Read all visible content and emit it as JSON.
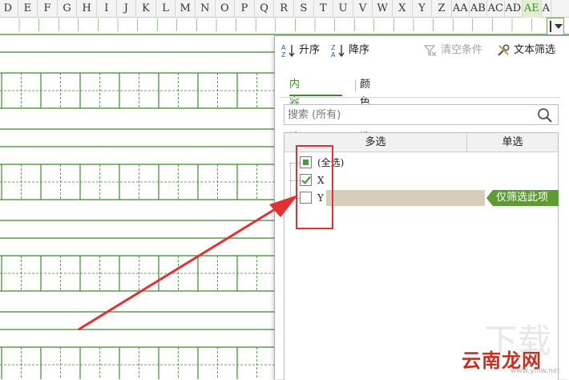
{
  "columns": [
    "D",
    "E",
    "F",
    "G",
    "H",
    "I",
    "J",
    "K",
    "L",
    "M",
    "N",
    "O",
    "P",
    "Q",
    "R",
    "S",
    "T",
    "U",
    "V",
    "W",
    "X",
    "Y",
    "Z",
    "AA",
    "AB",
    "AC",
    "AD",
    "AE",
    "A"
  ],
  "active_column": "AE",
  "toolbar": {
    "sort_asc": "升序",
    "sort_desc": "降序",
    "clear_conditions": "清空条件",
    "text_filter": "文本筛选"
  },
  "tabs": [
    {
      "label": "内容筛选",
      "active": true
    },
    {
      "label": "颜色筛选",
      "active": false
    }
  ],
  "search": {
    "placeholder": "搜索 (所有)"
  },
  "list": {
    "header_multi": "多选",
    "header_single": "单选",
    "items": [
      {
        "label": "(全选)",
        "state": "partial"
      },
      {
        "label": "X",
        "state": "checked"
      },
      {
        "label": "Y",
        "state": "unchecked",
        "hovered": true
      }
    ],
    "only_this_label": "仅筛选此项"
  },
  "colors": {
    "accent_green": "#3f8f2f",
    "grid_green": "#3a8a2a",
    "annotation_red": "#e33030",
    "only_this_bg": "#5e9b34"
  },
  "watermark": {
    "brand": "云南龙网",
    "url": "www.ynlw.net"
  }
}
